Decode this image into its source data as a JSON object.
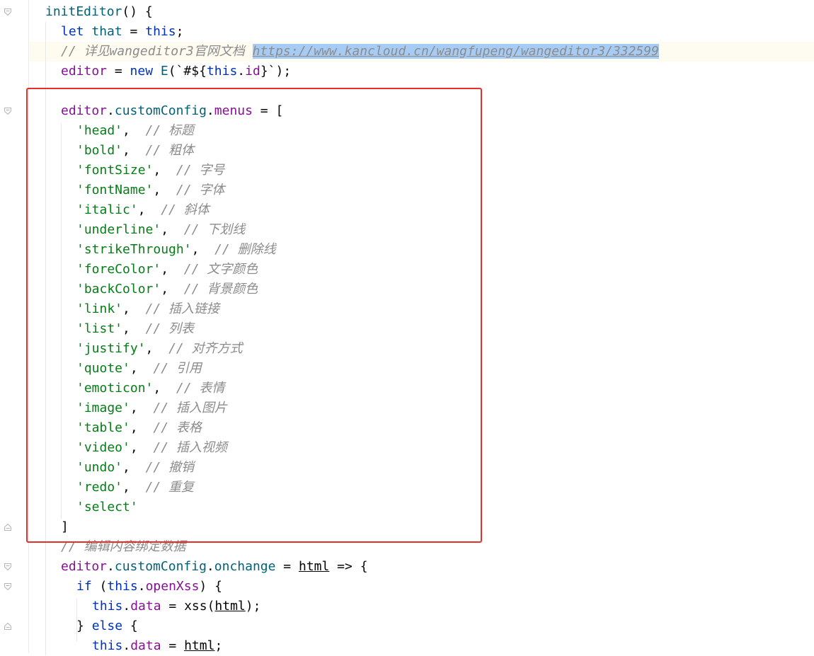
{
  "editor": {
    "lines": [
      {
        "indent": 0,
        "tokens": [
          {
            "t": "initEditor",
            "c": "fnname"
          },
          {
            "t": "() {",
            "c": ""
          }
        ]
      },
      {
        "indent": 1,
        "tokens": [
          {
            "t": "let ",
            "c": "kw"
          },
          {
            "t": "that",
            "c": "fn"
          },
          {
            "t": " = ",
            "c": ""
          },
          {
            "t": "this",
            "c": "kw"
          },
          {
            "t": ";",
            "c": ""
          }
        ]
      },
      {
        "indent": 1,
        "tokens": [
          {
            "t": "// 详见wangeditor3官网文档 ",
            "c": "cm"
          },
          {
            "t": "https://www.kancloud.cn/wangfupeng/wangeditor3/332599",
            "c": "url"
          }
        ]
      },
      {
        "indent": 1,
        "tokens": [
          {
            "t": "editor",
            "c": "var"
          },
          {
            "t": " = ",
            "c": ""
          },
          {
            "t": "new ",
            "c": "kw"
          },
          {
            "t": "E",
            "c": "meth"
          },
          {
            "t": "(`#${",
            "c": ""
          },
          {
            "t": "this",
            "c": "kw"
          },
          {
            "t": ".",
            "c": ""
          },
          {
            "t": "id",
            "c": "var"
          },
          {
            "t": "}`);",
            "c": ""
          }
        ]
      },
      {
        "indent": 0,
        "tokens": []
      },
      {
        "indent": 1,
        "tokens": [
          {
            "t": "editor",
            "c": "var"
          },
          {
            "t": ".",
            "c": ""
          },
          {
            "t": "customConfig",
            "c": "meth"
          },
          {
            "t": ".",
            "c": ""
          },
          {
            "t": "menus",
            "c": "var"
          },
          {
            "t": " = [",
            "c": ""
          }
        ]
      },
      {
        "indent": 2,
        "tokens": [
          {
            "t": "'head'",
            "c": "str"
          },
          {
            "t": ",  ",
            "c": ""
          },
          {
            "t": "// 标题",
            "c": "cm"
          }
        ]
      },
      {
        "indent": 2,
        "tokens": [
          {
            "t": "'bold'",
            "c": "str"
          },
          {
            "t": ",  ",
            "c": ""
          },
          {
            "t": "// 粗体",
            "c": "cm"
          }
        ]
      },
      {
        "indent": 2,
        "tokens": [
          {
            "t": "'fontSize'",
            "c": "str"
          },
          {
            "t": ",  ",
            "c": ""
          },
          {
            "t": "// 字号",
            "c": "cm"
          }
        ]
      },
      {
        "indent": 2,
        "tokens": [
          {
            "t": "'fontName'",
            "c": "str"
          },
          {
            "t": ",  ",
            "c": ""
          },
          {
            "t": "// 字体",
            "c": "cm"
          }
        ]
      },
      {
        "indent": 2,
        "tokens": [
          {
            "t": "'italic'",
            "c": "str"
          },
          {
            "t": ",  ",
            "c": ""
          },
          {
            "t": "// 斜体",
            "c": "cm"
          }
        ]
      },
      {
        "indent": 2,
        "tokens": [
          {
            "t": "'underline'",
            "c": "str"
          },
          {
            "t": ",  ",
            "c": ""
          },
          {
            "t": "// 下划线",
            "c": "cm"
          }
        ]
      },
      {
        "indent": 2,
        "tokens": [
          {
            "t": "'strikeThrough'",
            "c": "str"
          },
          {
            "t": ",  ",
            "c": ""
          },
          {
            "t": "// 删除线",
            "c": "cm"
          }
        ]
      },
      {
        "indent": 2,
        "tokens": [
          {
            "t": "'foreColor'",
            "c": "str"
          },
          {
            "t": ",  ",
            "c": ""
          },
          {
            "t": "// 文字颜色",
            "c": "cm"
          }
        ]
      },
      {
        "indent": 2,
        "tokens": [
          {
            "t": "'backColor'",
            "c": "str"
          },
          {
            "t": ",  ",
            "c": ""
          },
          {
            "t": "// 背景颜色",
            "c": "cm"
          }
        ]
      },
      {
        "indent": 2,
        "tokens": [
          {
            "t": "'link'",
            "c": "str"
          },
          {
            "t": ",  ",
            "c": ""
          },
          {
            "t": "// 插入链接",
            "c": "cm"
          }
        ]
      },
      {
        "indent": 2,
        "tokens": [
          {
            "t": "'list'",
            "c": "str"
          },
          {
            "t": ",  ",
            "c": ""
          },
          {
            "t": "// 列表",
            "c": "cm"
          }
        ]
      },
      {
        "indent": 2,
        "tokens": [
          {
            "t": "'justify'",
            "c": "str"
          },
          {
            "t": ",  ",
            "c": ""
          },
          {
            "t": "// 对齐方式",
            "c": "cm"
          }
        ]
      },
      {
        "indent": 2,
        "tokens": [
          {
            "t": "'quote'",
            "c": "str"
          },
          {
            "t": ",  ",
            "c": ""
          },
          {
            "t": "// 引用",
            "c": "cm"
          }
        ]
      },
      {
        "indent": 2,
        "tokens": [
          {
            "t": "'emoticon'",
            "c": "str"
          },
          {
            "t": ",  ",
            "c": ""
          },
          {
            "t": "// 表情",
            "c": "cm"
          }
        ]
      },
      {
        "indent": 2,
        "tokens": [
          {
            "t": "'image'",
            "c": "str"
          },
          {
            "t": ",  ",
            "c": ""
          },
          {
            "t": "// 插入图片",
            "c": "cm"
          }
        ]
      },
      {
        "indent": 2,
        "tokens": [
          {
            "t": "'table'",
            "c": "str"
          },
          {
            "t": ",  ",
            "c": ""
          },
          {
            "t": "// 表格",
            "c": "cm"
          }
        ]
      },
      {
        "indent": 2,
        "tokens": [
          {
            "t": "'video'",
            "c": "str"
          },
          {
            "t": ",  ",
            "c": ""
          },
          {
            "t": "// 插入视频",
            "c": "cm"
          }
        ]
      },
      {
        "indent": 2,
        "tokens": [
          {
            "t": "'undo'",
            "c": "str"
          },
          {
            "t": ",  ",
            "c": ""
          },
          {
            "t": "// 撤销",
            "c": "cm"
          }
        ]
      },
      {
        "indent": 2,
        "tokens": [
          {
            "t": "'redo'",
            "c": "str"
          },
          {
            "t": ",  ",
            "c": ""
          },
          {
            "t": "// 重复",
            "c": "cm"
          }
        ]
      },
      {
        "indent": 2,
        "tokens": [
          {
            "t": "'select'",
            "c": "str"
          }
        ]
      },
      {
        "indent": 1,
        "tokens": [
          {
            "t": "]",
            "c": ""
          }
        ]
      },
      {
        "indent": 1,
        "tokens": [
          {
            "t": "// 编辑内容绑定数据",
            "c": "cm"
          }
        ]
      },
      {
        "indent": 1,
        "tokens": [
          {
            "t": "editor",
            "c": "var"
          },
          {
            "t": ".",
            "c": ""
          },
          {
            "t": "customConfig",
            "c": "meth"
          },
          {
            "t": ".",
            "c": ""
          },
          {
            "t": "onchange",
            "c": "meth"
          },
          {
            "t": " = ",
            "c": ""
          },
          {
            "t": "html",
            "c": "param"
          },
          {
            "t": " => {",
            "c": ""
          }
        ]
      },
      {
        "indent": 2,
        "tokens": [
          {
            "t": "if ",
            "c": "kw"
          },
          {
            "t": "(",
            "c": ""
          },
          {
            "t": "this",
            "c": "kw"
          },
          {
            "t": ".",
            "c": ""
          },
          {
            "t": "openXss",
            "c": "var"
          },
          {
            "t": ") {",
            "c": ""
          }
        ]
      },
      {
        "indent": 3,
        "tokens": [
          {
            "t": "this",
            "c": "kw"
          },
          {
            "t": ".",
            "c": ""
          },
          {
            "t": "data",
            "c": "var"
          },
          {
            "t": " = xss(",
            "c": ""
          },
          {
            "t": "html",
            "c": "param"
          },
          {
            "t": ");",
            "c": ""
          }
        ]
      },
      {
        "indent": 2,
        "tokens": [
          {
            "t": "} ",
            "c": ""
          },
          {
            "t": "else ",
            "c": "kw"
          },
          {
            "t": "{",
            "c": ""
          }
        ]
      },
      {
        "indent": 3,
        "tokens": [
          {
            "t": "this",
            "c": "kw"
          },
          {
            "t": ".",
            "c": ""
          },
          {
            "t": "data",
            "c": "var"
          },
          {
            "t": " = ",
            "c": ""
          },
          {
            "t": "html",
            "c": "param"
          },
          {
            "t": ";",
            "c": ""
          }
        ]
      }
    ],
    "fold_markers": [
      {
        "line": 0,
        "kind": "open"
      },
      {
        "line": 5,
        "kind": "open"
      },
      {
        "line": 26,
        "kind": "close"
      },
      {
        "line": 28,
        "kind": "open"
      },
      {
        "line": 29,
        "kind": "open"
      },
      {
        "line": 31,
        "kind": "close"
      }
    ],
    "highlight_line": 2,
    "selection_box_color": "#e5302a"
  }
}
